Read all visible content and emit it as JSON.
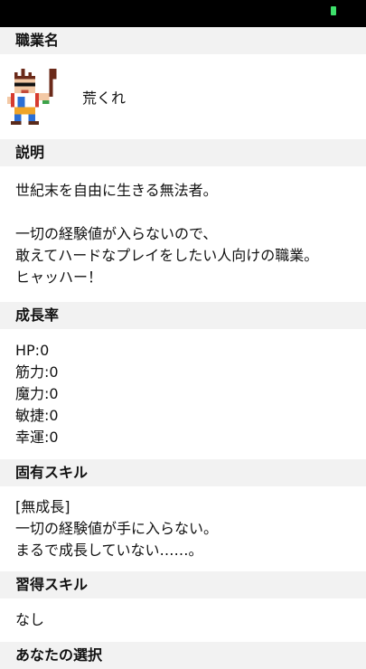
{
  "job": {
    "header": "職業名",
    "name": "荒くれ",
    "icon": "brute-sprite-icon"
  },
  "description": {
    "header": "説明",
    "lines": [
      "世紀末を自由に生きる無法者。",
      "",
      "一切の経験値が入らないので、",
      "敢えてハードなプレイをしたい人向けの職業。",
      "ヒャッハー！"
    ]
  },
  "growth": {
    "header": "成長率",
    "stats": [
      "HP:0",
      "筋力:0",
      "魔力:0",
      "敏捷:0",
      "幸運:0"
    ]
  },
  "unique_skill": {
    "header": "固有スキル",
    "lines": [
      "[無成長]",
      "一切の経験値が手に入らない。",
      "まるで成長していない……。"
    ]
  },
  "learned_skill": {
    "header": "習得スキル",
    "value": "なし"
  },
  "choice": {
    "header": "あなたの選択"
  },
  "status_bar": {
    "battery_color": "#3ee06b"
  }
}
